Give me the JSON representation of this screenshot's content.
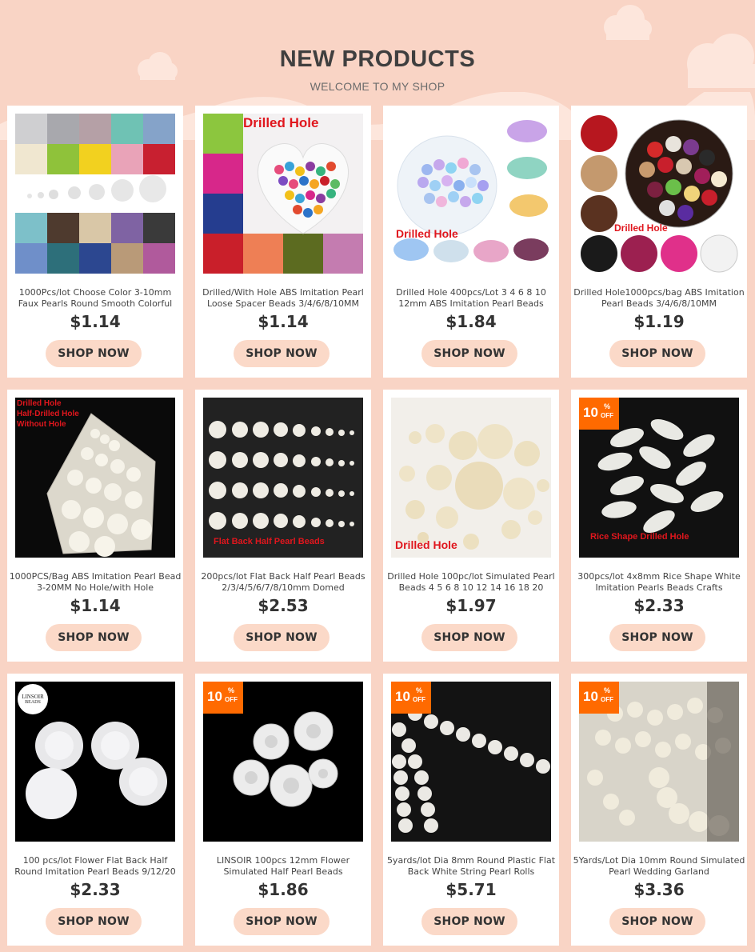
{
  "header": {
    "title": "NEW PRODUCTS",
    "subtitle": "WELCOME TO MY SHOP"
  },
  "colors": {
    "background": "#f9d4c5",
    "button": "#fbd9c8",
    "badge": "#ff6a00",
    "label_red": "#e0161d"
  },
  "products": [
    {
      "title": "1000Pcs/lot Choose Color 3-10mm Faux Pearls Round Smooth Colorful",
      "price": "$1.14",
      "cta": "SHOP NOW",
      "image_icon": "pearl-color-grid-image"
    },
    {
      "title": "Drilled/With Hole ABS Imitation Pearl Loose Spacer Beads 3/4/6/8/10MM",
      "price": "$1.14",
      "cta": "SHOP NOW",
      "image_icon": "heart-bowl-pearls-image",
      "overlay": "Drilled Hole"
    },
    {
      "title": "Drilled Hole 400pcs/Lot 3 4 6 8 10 12mm ABS Imitation Pearl Beads",
      "price": "$1.84",
      "cta": "SHOP NOW",
      "image_icon": "pastel-pearls-image",
      "overlay": "Drilled Hole"
    },
    {
      "title": "Drilled Hole1000pcs/bag ABS Imitation Pearl Beads 3/4/6/8/10MM",
      "price": "$1.19",
      "cta": "SHOP NOW",
      "image_icon": "colored-pearls-circle-image",
      "overlay": "Drilled Hole"
    },
    {
      "title": "1000PCS/Bag ABS Imitation Pearl Bead 3-20MM No Hole/with Hole",
      "price": "$1.14",
      "cta": "SHOP NOW",
      "image_icon": "pearl-bags-image",
      "overlay_lines": [
        "Drilled Hole",
        "Half-Drilled Hole",
        "Without Hole"
      ]
    },
    {
      "title": "200pcs/lot Flat Back Half Pearl Beads 2/3/4/5/6/7/8/10mm Domed",
      "price": "$2.53",
      "cta": "SHOP NOW",
      "image_icon": "half-pearls-rows-image",
      "overlay": "Flat Back Half Pearl Beads"
    },
    {
      "title": "Drilled Hole 100pc/lot Simulated Pearl Beads 4 5 6 8 10 12 14 16 18 20",
      "price": "$1.97",
      "cta": "SHOP NOW",
      "image_icon": "cream-pearls-image",
      "overlay": "Drilled Hole"
    },
    {
      "title": "300pcs/lot 4x8mm Rice Shape White Imitation Pearls Beads Crafts",
      "price": "$2.33",
      "cta": "SHOP NOW",
      "image_icon": "rice-pearls-image",
      "overlay": "Rice Shape Drilled Hole",
      "badge": {
        "num": "10",
        "pct": "%",
        "off": "OFF"
      }
    },
    {
      "title": "100 pcs/lot Flower Flat Back Half Round Imitation Pearl Beads 9/12/20",
      "price": "$2.33",
      "cta": "SHOP NOW",
      "image_icon": "flower-pearls-image",
      "logo": {
        "line1": "LINSOIR",
        "line2": "BEADS"
      }
    },
    {
      "title": "LINSOIR 100pcs 12mm Flower Simulated Half Pearl Beads",
      "price": "$1.86",
      "cta": "SHOP NOW",
      "image_icon": "rose-pearls-image",
      "badge": {
        "num": "10",
        "pct": "%",
        "off": "OFF"
      }
    },
    {
      "title": "5yards/lot Dia 8mm Round Plastic Flat Back White String Pearl Rolls",
      "price": "$5.71",
      "cta": "SHOP NOW",
      "image_icon": "pearl-string-image",
      "badge": {
        "num": "10",
        "pct": "%",
        "off": "OFF"
      }
    },
    {
      "title": "5Yards/Lot Dia 10mm Round Simulated Pearl Wedding Garland",
      "price": "$3.36",
      "cta": "SHOP NOW",
      "image_icon": "pearl-garland-image",
      "badge": {
        "num": "10",
        "pct": "%",
        "off": "OFF"
      }
    }
  ]
}
